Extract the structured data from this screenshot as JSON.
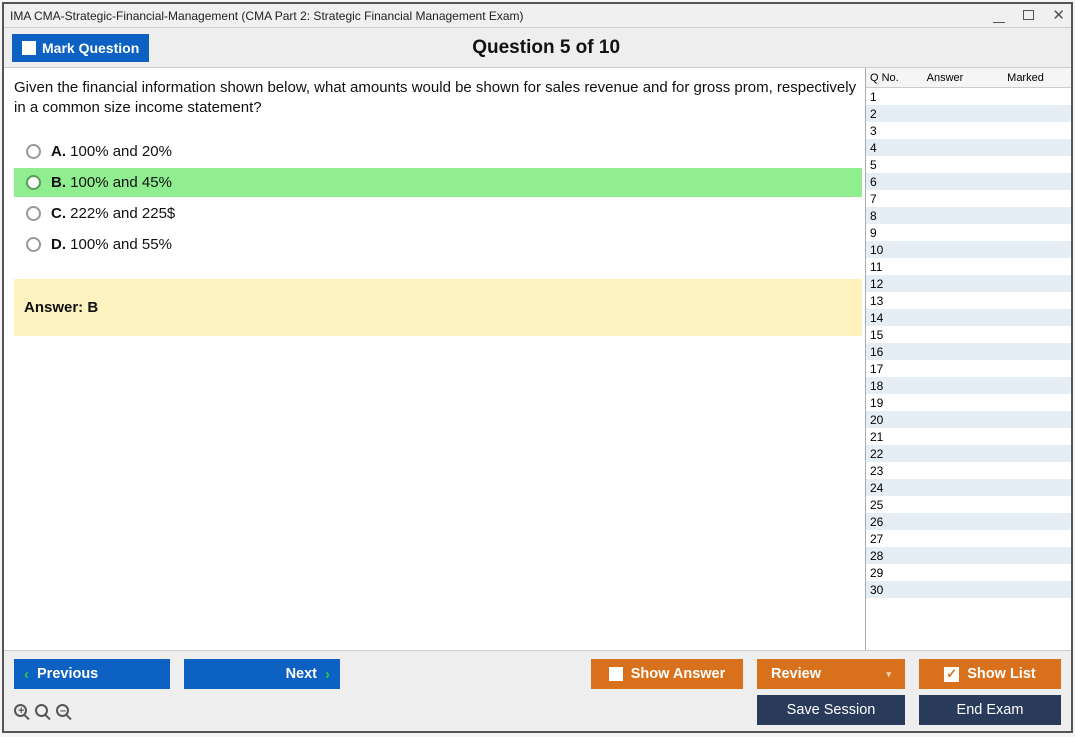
{
  "window": {
    "title": "IMA CMA-Strategic-Financial-Management (CMA Part 2: Strategic Financial Management Exam)"
  },
  "header": {
    "mark_label": "Mark Question",
    "question_title": "Question 5 of 10"
  },
  "question": {
    "text": "Given the financial information shown below, what amounts would be shown for sales revenue and for gross prom, respectively in a common size income statement?",
    "choices": [
      {
        "letter": "A.",
        "text": "100% and 20%",
        "correct": false
      },
      {
        "letter": "B.",
        "text": "100% and 45%",
        "correct": true
      },
      {
        "letter": "C.",
        "text": "222% and 225$",
        "correct": false
      },
      {
        "letter": "D.",
        "text": "100% and 55%",
        "correct": false
      }
    ],
    "answer_label": "Answer: B"
  },
  "sidebar": {
    "headers": {
      "qno": "Q No.",
      "answer": "Answer",
      "marked": "Marked"
    },
    "rows": [
      {
        "q": "1"
      },
      {
        "q": "2"
      },
      {
        "q": "3"
      },
      {
        "q": "4"
      },
      {
        "q": "5"
      },
      {
        "q": "6"
      },
      {
        "q": "7"
      },
      {
        "q": "8"
      },
      {
        "q": "9"
      },
      {
        "q": "10"
      },
      {
        "q": "11"
      },
      {
        "q": "12"
      },
      {
        "q": "13"
      },
      {
        "q": "14"
      },
      {
        "q": "15"
      },
      {
        "q": "16"
      },
      {
        "q": "17"
      },
      {
        "q": "18"
      },
      {
        "q": "19"
      },
      {
        "q": "20"
      },
      {
        "q": "21"
      },
      {
        "q": "22"
      },
      {
        "q": "23"
      },
      {
        "q": "24"
      },
      {
        "q": "25"
      },
      {
        "q": "26"
      },
      {
        "q": "27"
      },
      {
        "q": "28"
      },
      {
        "q": "29"
      },
      {
        "q": "30"
      }
    ]
  },
  "footer": {
    "previous": "Previous",
    "next": "Next",
    "show_answer": "Show Answer",
    "review": "Review",
    "show_list": "Show List",
    "save_session": "Save Session",
    "end_exam": "End Exam"
  }
}
